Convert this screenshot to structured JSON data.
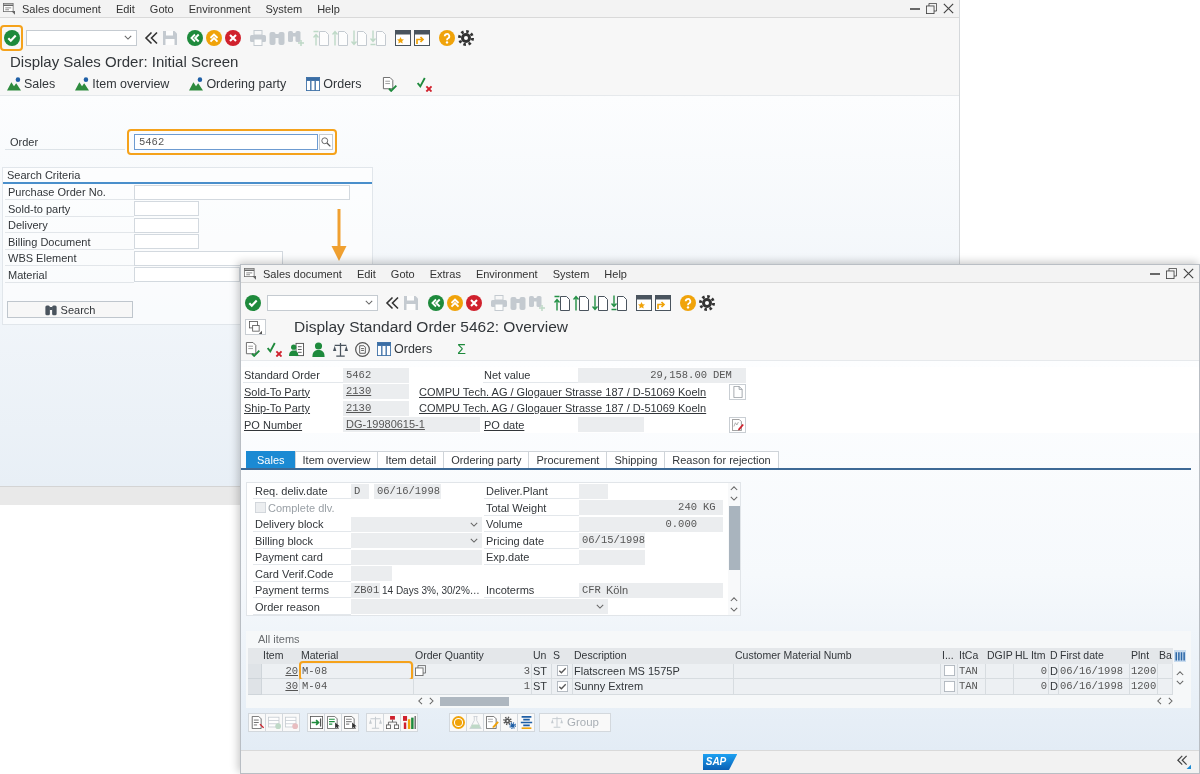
{
  "initial_screen": {
    "menu": [
      "Sales document",
      "Edit",
      "Goto",
      "Environment",
      "System",
      "Help"
    ],
    "system_toolbar": {
      "enter": {
        "highlighted": true
      },
      "buttons": [
        {
          "kind": "back-double",
          "disabled": false
        },
        {
          "kind": "save",
          "disabled": true
        },
        {
          "kind": "back",
          "disabled": false
        },
        {
          "kind": "exit",
          "disabled": false
        },
        {
          "kind": "cancel",
          "disabled": false
        },
        {
          "kind": "print",
          "disabled": true
        },
        {
          "kind": "find",
          "disabled": true
        },
        {
          "kind": "find-next",
          "disabled": true
        },
        {
          "kind": "first-page",
          "disabled": true
        },
        {
          "kind": "previous-page",
          "disabled": true
        },
        {
          "kind": "next-page",
          "disabled": true
        },
        {
          "kind": "last-page",
          "disabled": true
        },
        {
          "kind": "new-session",
          "disabled": false
        },
        {
          "kind": "shortcut",
          "disabled": false
        },
        {
          "kind": "help",
          "disabled": false
        },
        {
          "kind": "settings",
          "disabled": false
        }
      ]
    },
    "title": "Display Sales Order: Initial Screen",
    "app_toolbar": [
      {
        "kind": "navigate",
        "label": "Sales"
      },
      {
        "kind": "navigate",
        "label": "Item overview"
      },
      {
        "kind": "navigate",
        "label": "Ordering party"
      },
      {
        "kind": "list",
        "label": "Orders"
      },
      {
        "kind": "document-check"
      },
      {
        "kind": "check-cross"
      }
    ],
    "order": {
      "label": "Order",
      "value": "5462",
      "highlighted": true
    },
    "search_criteria": {
      "title": "Search Criteria",
      "fields": [
        "Purchase Order No.",
        "Sold-to party",
        "Delivery",
        "Billing Document",
        "WBS Element",
        "Material"
      ],
      "search_button": "Search"
    }
  },
  "overview_screen": {
    "menu": [
      "Sales document",
      "Edit",
      "Goto",
      "Extras",
      "Environment",
      "System",
      "Help"
    ],
    "system_toolbar": {
      "enter": {
        "highlighted": false
      },
      "buttons": [
        {
          "kind": "back-double",
          "disabled": false
        },
        {
          "kind": "save",
          "disabled": true
        },
        {
          "kind": "back",
          "disabled": false
        },
        {
          "kind": "exit",
          "disabled": false
        },
        {
          "kind": "cancel",
          "disabled": false
        },
        {
          "kind": "print",
          "disabled": true
        },
        {
          "kind": "find",
          "disabled": true
        },
        {
          "kind": "find-next",
          "disabled": true
        },
        {
          "kind": "first-page",
          "disabled": false
        },
        {
          "kind": "previous-page",
          "disabled": false
        },
        {
          "kind": "next-page",
          "disabled": false
        },
        {
          "kind": "last-page",
          "disabled": false
        },
        {
          "kind": "new-session",
          "disabled": false
        },
        {
          "kind": "shortcut",
          "disabled": false
        },
        {
          "kind": "help",
          "disabled": false
        },
        {
          "kind": "settings",
          "disabled": false
        }
      ]
    },
    "title": "Display Standard Order 5462: Overview",
    "app_toolbar": [
      {
        "kind": "document-check"
      },
      {
        "kind": "check-cross"
      },
      {
        "kind": "person-card"
      },
      {
        "kind": "person"
      },
      {
        "kind": "scales"
      },
      {
        "kind": "document-circle"
      },
      {
        "kind": "list",
        "label": "Orders"
      },
      {
        "kind": "symbol",
        "label": "Σ"
      }
    ],
    "header": {
      "order_type": {
        "label": "Standard Order",
        "value": "5462"
      },
      "net_value": {
        "label": "Net value",
        "value": "29,158.00",
        "currency": "DEM"
      },
      "partners": [
        {
          "label": "Sold-To Party",
          "number": "2130",
          "address": "COMPU Tech. AG / Glogauer Strasse 187 / D-51069 Koeln"
        },
        {
          "label": "Ship-To Party",
          "number": "2130",
          "address": "COMPU Tech. AG / Glogauer Strasse 187 / D-51069 Koeln"
        }
      ],
      "po_number": {
        "label": "PO Number",
        "value": "DG-19980615-1"
      },
      "po_date": {
        "label": "PO date"
      }
    },
    "tabs": [
      {
        "label": "Sales",
        "selected": true
      },
      {
        "label": "Item overview",
        "selected": false
      },
      {
        "label": "Item detail",
        "selected": false
      },
      {
        "label": "Ordering party",
        "selected": false
      },
      {
        "label": "Procurement",
        "selected": false
      },
      {
        "label": "Shipping",
        "selected": false
      },
      {
        "label": "Reason for rejection",
        "selected": false
      }
    ],
    "sales_panel": {
      "rows": [
        {
          "left": {
            "kind": "code-date",
            "label": "Req. deliv.date",
            "code": "D",
            "value": "06/16/1998"
          },
          "right": {
            "kind": "plant",
            "label": "Deliver.Plant"
          }
        },
        {
          "left": {
            "kind": "checkbox",
            "label": "Complete dlv.",
            "checked": false,
            "disabled": true
          },
          "right": {
            "kind": "measure",
            "label": "Total Weight",
            "value": "240",
            "unit": "KG"
          }
        },
        {
          "left": {
            "kind": "dropdown",
            "label": "Delivery block"
          },
          "right": {
            "kind": "measure",
            "label": "Volume",
            "value": "0.000"
          }
        },
        {
          "left": {
            "kind": "dropdown",
            "label": "Billing block"
          },
          "right": {
            "kind": "date",
            "label": "Pricing date",
            "value": "06/15/1998"
          }
        },
        {
          "left": {
            "kind": "card",
            "label": "Payment card"
          },
          "right": {
            "kind": "date",
            "label": "Exp.date"
          }
        },
        {
          "left": {
            "kind": "short",
            "label": "Card Verif.Code"
          }
        },
        {
          "left": {
            "kind": "code-text",
            "label": "Payment terms",
            "code": "ZB01",
            "text": "14 Days 3%, 30/2%…"
          },
          "right": {
            "kind": "code-field",
            "label": "Incoterms",
            "code": "CFR",
            "text": "Köln"
          }
        },
        {
          "left": {
            "kind": "wide-dropdown",
            "label": "Order reason"
          }
        }
      ]
    },
    "items": {
      "title": "All items",
      "columns": [
        "Item",
        "Material",
        "Order Quantity",
        "Un",
        "S",
        "Description",
        "Customer Material Numb",
        "I...",
        "ItCa",
        "DGIP",
        "HL Itm",
        "D",
        "First date",
        "Plnt",
        "Ba"
      ],
      "rows": [
        {
          "item": "20",
          "material": "M-08",
          "quantity": "3",
          "unit": "ST",
          "confirmed": true,
          "description": "Flatscreen MS 1575P",
          "flagged": false,
          "item_category": "TAN",
          "hl_item": "0",
          "d": "D",
          "first_date": "06/16/1998",
          "plant": "1200",
          "focused": true,
          "material_highlighted": true
        },
        {
          "item": "30",
          "material": "M-04",
          "quantity": "1",
          "unit": "ST",
          "confirmed": true,
          "description": "Sunny Extrem",
          "flagged": false,
          "item_category": "TAN",
          "hl_item": "0",
          "d": "D",
          "first_date": "06/16/1998",
          "plant": "1200",
          "focused": false,
          "material_highlighted": false
        }
      ]
    },
    "item_toolbar": {
      "buttons": [
        {
          "kind": "details",
          "disabled": false
        },
        {
          "kind": "insert-row",
          "disabled": true
        },
        {
          "kind": "delete-row",
          "disabled": true
        },
        {
          "kind": "move-in",
          "disabled": false
        },
        {
          "kind": "select-all",
          "disabled": false
        },
        {
          "kind": "deselect-all",
          "disabled": false
        },
        {
          "kind": "scales",
          "disabled": true
        },
        {
          "kind": "hierarchy",
          "disabled": false
        },
        {
          "kind": "chart",
          "disabled": false
        },
        {
          "kind": "price",
          "disabled": false
        },
        {
          "kind": "flask",
          "disabled": true
        },
        {
          "kind": "edit-doc",
          "disabled": false
        },
        {
          "kind": "configure",
          "disabled": false
        },
        {
          "kind": "stack",
          "disabled": false
        }
      ],
      "group_button": {
        "label": "Group",
        "disabled": true
      }
    },
    "status_bar": {
      "logo": "SAP"
    }
  }
}
